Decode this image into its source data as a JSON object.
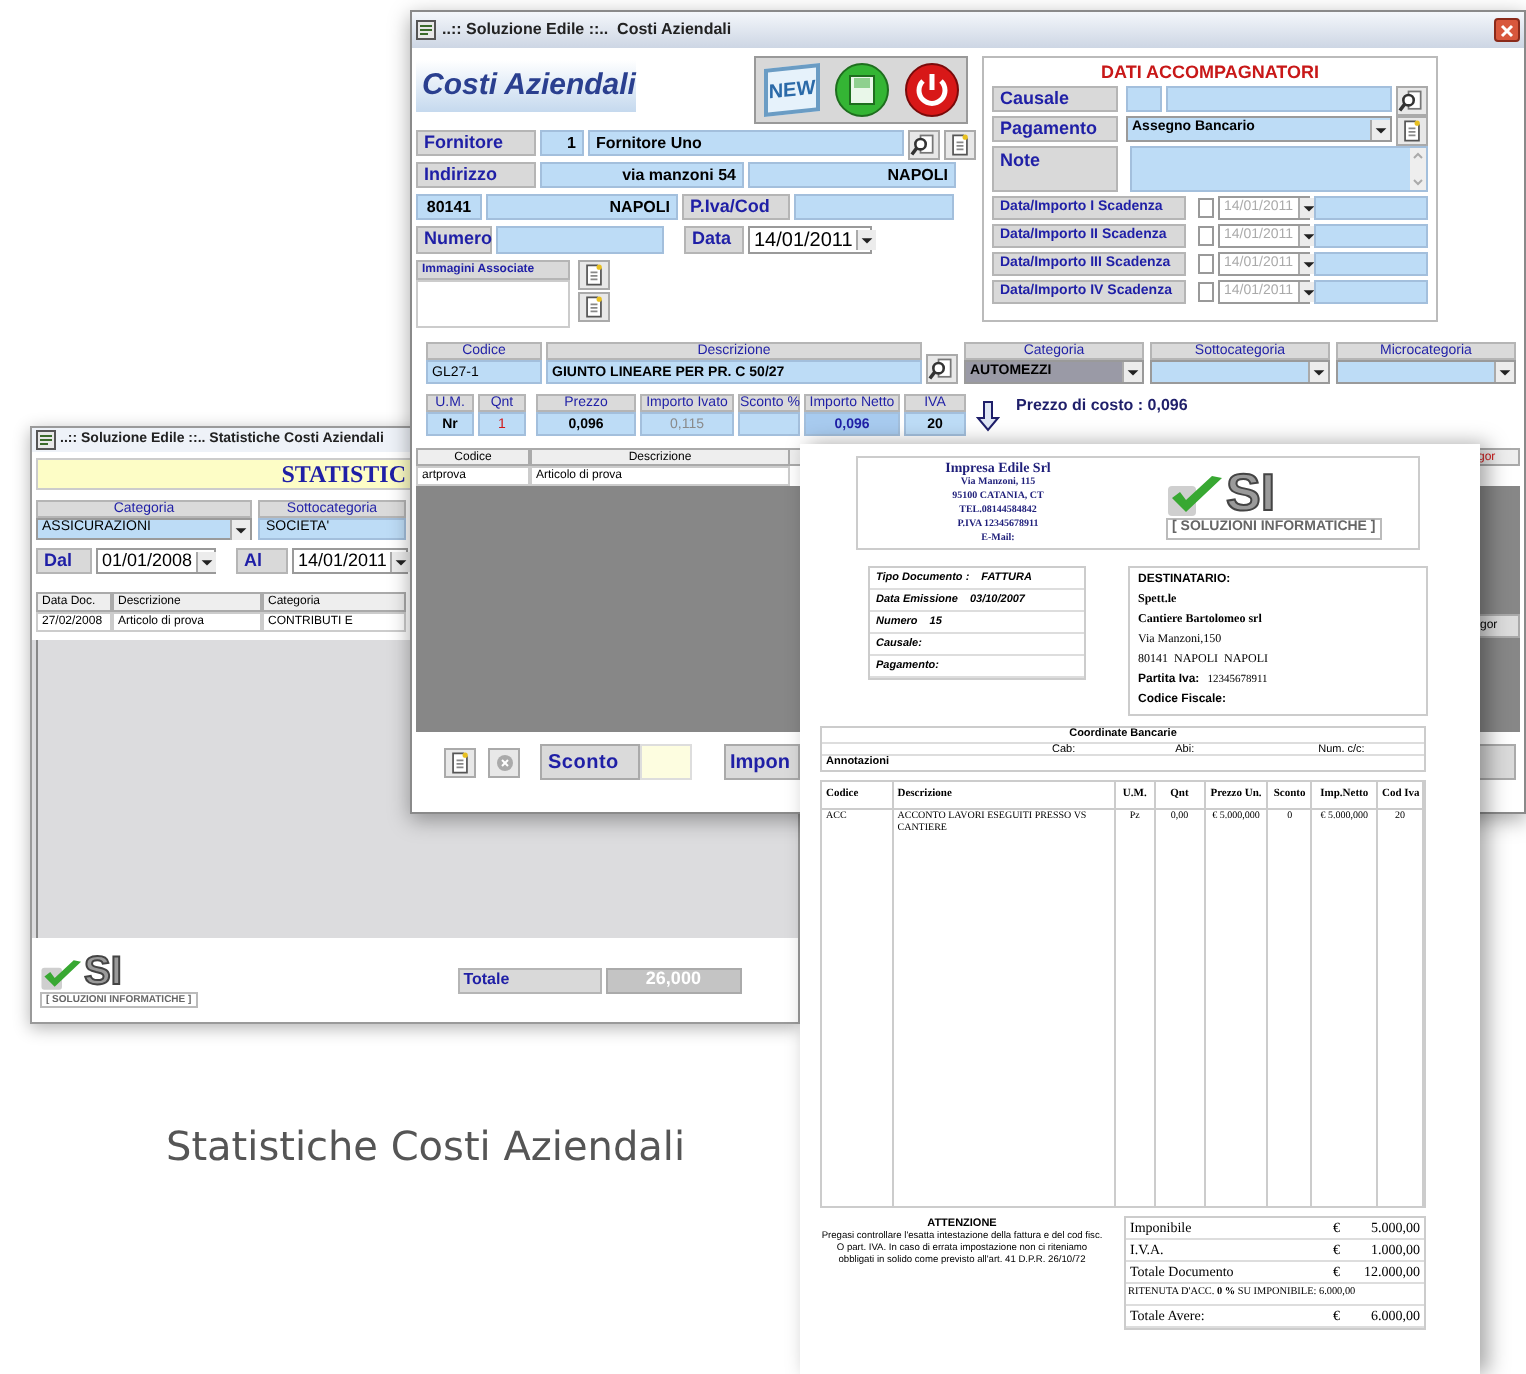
{
  "main_window": {
    "title": "..:: Soluzione Edile ::..  Costi Aziendali",
    "logo_text": "Costi Aziendali",
    "toolbar": [
      {
        "kind": "new",
        "label": "NEW"
      },
      {
        "kind": "save"
      },
      {
        "kind": "power"
      }
    ],
    "supplier": {
      "label": "Fornitore",
      "code": "1",
      "name": "Fornitore Uno"
    },
    "address": {
      "label": "Indirizzo",
      "street": "via manzoni 54",
      "city": "NAPOLI"
    },
    "postal": {
      "cap": "80141",
      "city": "NAPOLI",
      "vat_label": "P.Iva/Cod"
    },
    "number": {
      "label": "Numero",
      "date_label": "Data",
      "date": "14/01/2011"
    },
    "images": {
      "label": "Immagini Associate"
    },
    "accompanying": {
      "title": "DATI ACCOMPAGNATORI",
      "causale_label": "Causale",
      "payment_label": "Pagamento",
      "payment": "Assegno Bancario",
      "note_label": "Note",
      "due_dates": [
        {
          "label": "Data/Importo I Scadenza",
          "date": "14/01/2011",
          "checked": false
        },
        {
          "label": "Data/Importo II Scadenza",
          "date": "14/01/2011",
          "checked": false
        },
        {
          "label": "Data/Importo III Scadenza",
          "date": "14/01/2011",
          "checked": false
        },
        {
          "label": "Data/Importo IV  Scadenza",
          "date": "14/01/2011",
          "checked": false
        }
      ]
    },
    "article": {
      "code_header": "Codice",
      "desc_header": "Descrizione",
      "code": "GL27-1",
      "description": "GIUNTO LINEARE PER PR. C 50/27",
      "categories": [
        {
          "header": "Categoria",
          "value": "AUTOMEZZI",
          "focused": true
        },
        {
          "header": "Sottocategoria",
          "focused": false
        },
        {
          "header": "Microcategoria",
          "focused": false
        }
      ],
      "amounts": [
        {
          "header": "U.M.",
          "value": "Nr",
          "kind": "plain"
        },
        {
          "header": "Qnt",
          "value": "1",
          "kind": "quantity"
        },
        {
          "header": "Prezzo",
          "value": "0,096",
          "kind": "plain"
        },
        {
          "header": "Importo Ivato",
          "value": "0,115",
          "kind": "computed"
        },
        {
          "header": "Sconto %",
          "kind": "plain"
        },
        {
          "header": "Importo Netto",
          "value": "0,096",
          "kind": "net"
        },
        {
          "header": "IVA",
          "value": "20",
          "kind": "plain"
        }
      ],
      "cost_price": "Prezzo di costo : 0,096"
    },
    "lines_table": {
      "columns": [
        "Codice",
        "Descrizione"
      ],
      "rows": [
        [
          "artprova",
          "Articolo di prova"
        ]
      ],
      "cut_column": "gor"
    },
    "side_label": "gor",
    "footer": {
      "discount_label": "Sconto",
      "taxable_label": "Impon"
    }
  },
  "back_window": {
    "title": "..:: Soluzione Edile ::.. Statistiche Costi Aziendali",
    "banner": "STATISTIC",
    "filters": [
      {
        "header": "Categoria",
        "value": "ASSICURAZIONI"
      },
      {
        "header": "Sottocategoria",
        "value": "SOCIETA'"
      }
    ],
    "from_label": "Dal",
    "from": "01/01/2008",
    "to_label": "Al",
    "to": "14/01/2011",
    "table": {
      "columns": [
        "Data Doc.",
        "Descrizione",
        "Categoria"
      ],
      "rows": [
        [
          "27/02/2008",
          "Articolo di prova",
          "CONTRIBUTI E"
        ]
      ]
    },
    "logo": {
      "mark": "SI",
      "tagline": "[ SOLUZIONI INFORMATICHE ]"
    },
    "total_label": "Totale",
    "total": "26,000"
  },
  "invoice": {
    "company": [
      "Impresa Edile Srl",
      "Via Manzoni, 115",
      "95100 CATANIA, CT",
      "TEL.08144584842",
      "P.IVA 12345678911",
      "E-Mail:"
    ],
    "logo": {
      "mark": "SI",
      "tagline": "[ SOLUZIONI INFORMATICHE ]"
    },
    "document": [
      {
        "label": "Tipo Documento :",
        "value": "FATTURA"
      },
      {
        "label": "Data Emissione",
        "value": "03/10/2007"
      },
      {
        "label": "Numero",
        "value": "15"
      },
      {
        "label": "Causale:"
      },
      {
        "label": "Pagamento:"
      }
    ],
    "recipient": {
      "title": "DESTINATARIO:",
      "lines": [
        "Spett.le",
        "Cantiere Bartolomeo srl",
        "Via Manzoni,150",
        "80141  NAPOLI  NAPOLI"
      ],
      "vat_label": "Partita Iva:",
      "vat": "12345678911",
      "tax_code_label": "Codice Fiscale:"
    },
    "bank": {
      "title": "Coordinate Bancarie",
      "fields": [
        "Cab:",
        "Abi:",
        "Num. c/c:"
      ],
      "notes_label": "Annotazioni"
    },
    "table": {
      "columns": [
        "Codice",
        "Descrizione",
        "U.M.",
        "Qnt",
        "Prezzo Un.",
        "Sconto",
        "Imp.Netto",
        "Cod Iva"
      ],
      "rows": [
        [
          "ACC",
          "ACCONTO LAVORI ESEGUITI PRESSO VS CANTIERE",
          "Pz",
          "0,00",
          "€ 5.000,000",
          "0",
          "€ 5.000,000",
          "20"
        ]
      ]
    },
    "notice": {
      "title": "ATTENZIONE",
      "text": "Pregasi controllare l'esatta intestazione della fattura e del cod fisc. O part. IVA. In caso di errata impostazione non ci riteniamo obbligati in solido come previsto all'art. 41 D.P.R. 26/10/72"
    },
    "totals": [
      {
        "kind": "amount",
        "label": "Imponibile",
        "currency": "€",
        "amount": "5.000,00"
      },
      {
        "kind": "amount",
        "label": "I.V.A.",
        "currency": "€",
        "amount": "1.000,00"
      },
      {
        "kind": "amount",
        "label": "Totale Documento",
        "currency": "€",
        "amount": "12.000,00"
      },
      {
        "kind": "note",
        "label": "RITENUTA D'ACC. **0 %** SU IMPONIBILE: 6.000,00"
      },
      {
        "kind": "amount",
        "label": "Totale Avere:",
        "currency": "€",
        "amount": "6.000,00"
      }
    ]
  },
  "caption": "Statistiche Costi Aziendali"
}
